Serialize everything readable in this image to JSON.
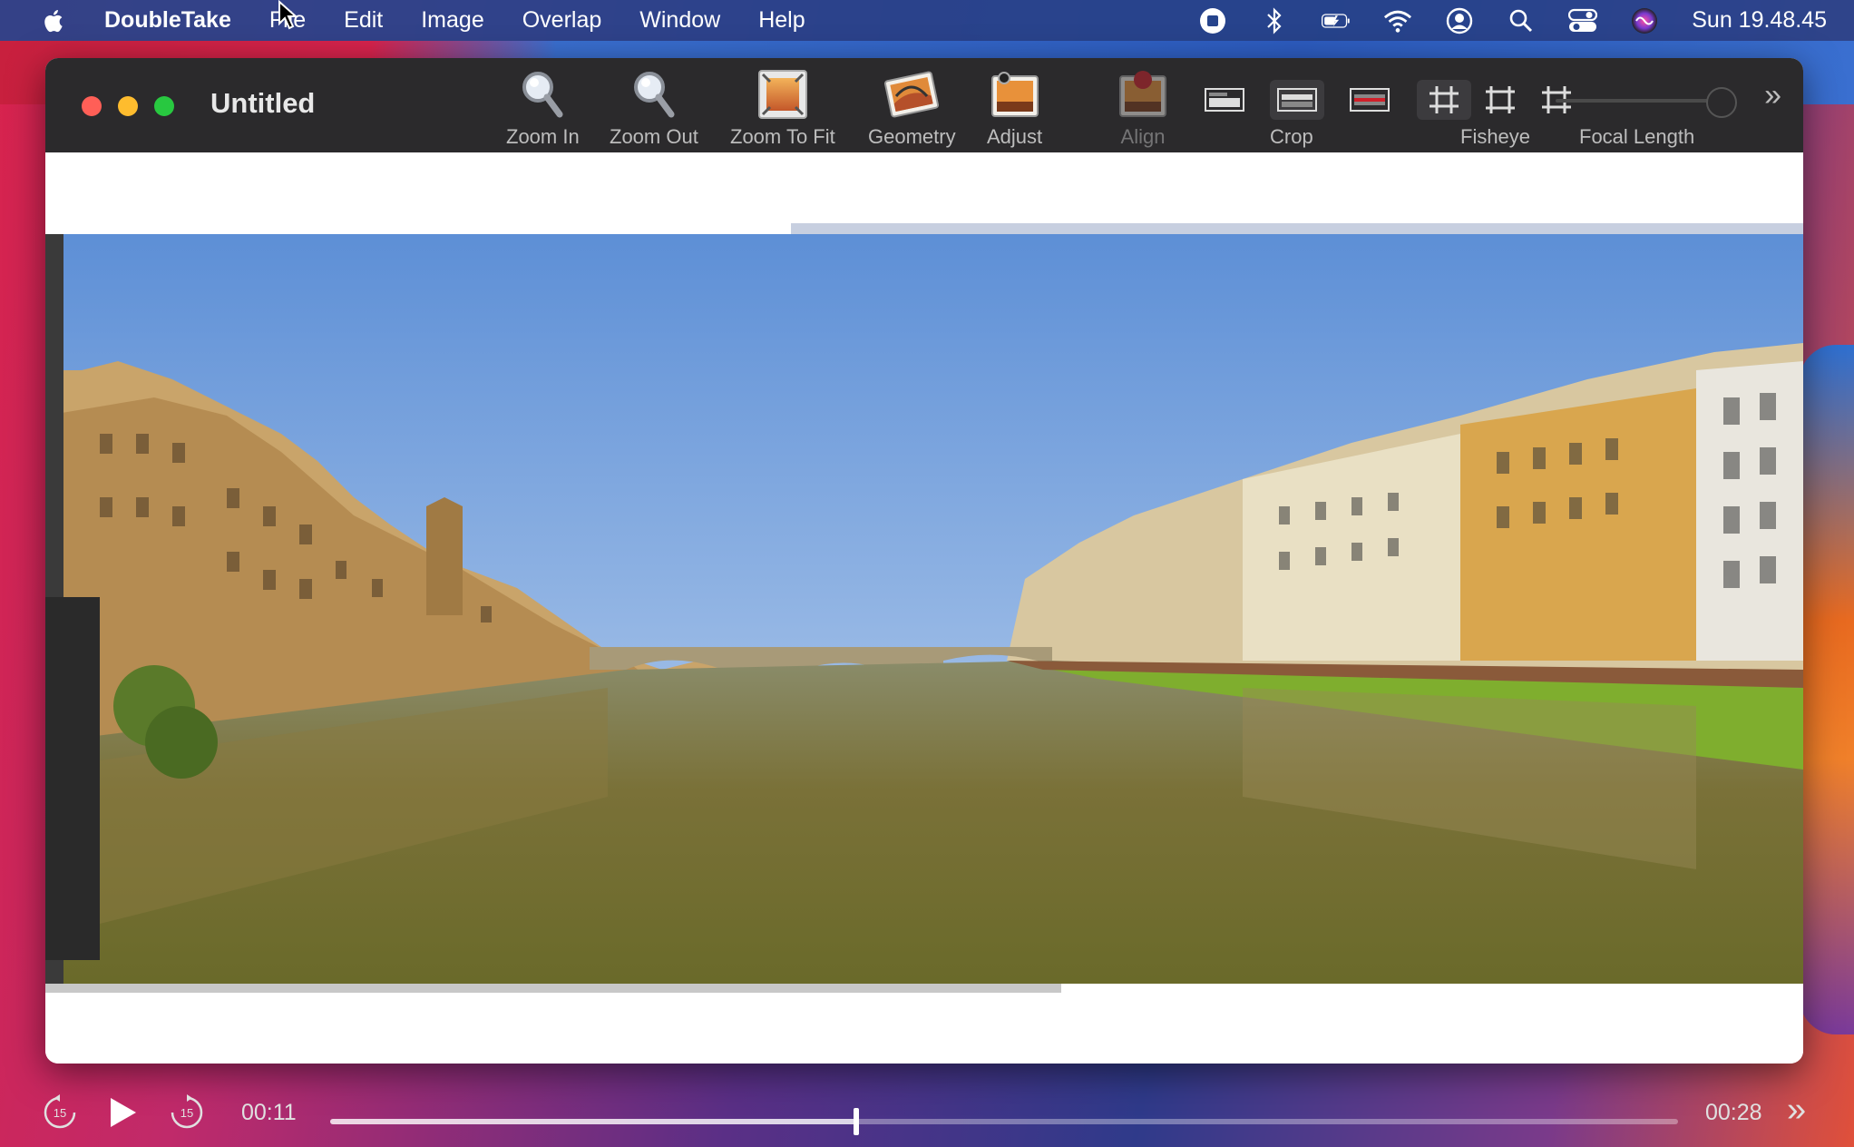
{
  "menubar": {
    "app_name": "DoubleTake",
    "items": [
      "File",
      "Edit",
      "Image",
      "Overlap",
      "Window",
      "Help"
    ],
    "clock": "Sun 19.48.45",
    "status_icons": [
      "screen-record-icon",
      "bluetooth-icon",
      "battery-icon",
      "wifi-icon",
      "user-icon",
      "search-icon",
      "control-center-icon",
      "siri-icon"
    ]
  },
  "window": {
    "title": "Untitled",
    "toolbar": {
      "zoom_in": "Zoom In",
      "zoom_out": "Zoom Out",
      "zoom_to_fit": "Zoom To Fit",
      "geometry": "Geometry",
      "adjust": "Adjust",
      "align": "Align",
      "crop": "Crop",
      "fisheye": "Fisheye",
      "focal_length": "Focal Length",
      "focal_length_level": 0.95
    }
  },
  "player": {
    "current_time": "00:11",
    "total_time": "00:28",
    "skip_back_seconds": "15",
    "skip_forward_seconds": "15",
    "progress": 0.39
  },
  "colors": {
    "menubar_bg": "#26448c",
    "toolbar_bg": "#2b2a2c",
    "sky": "#6f9ad6",
    "water": "#7a7138"
  }
}
